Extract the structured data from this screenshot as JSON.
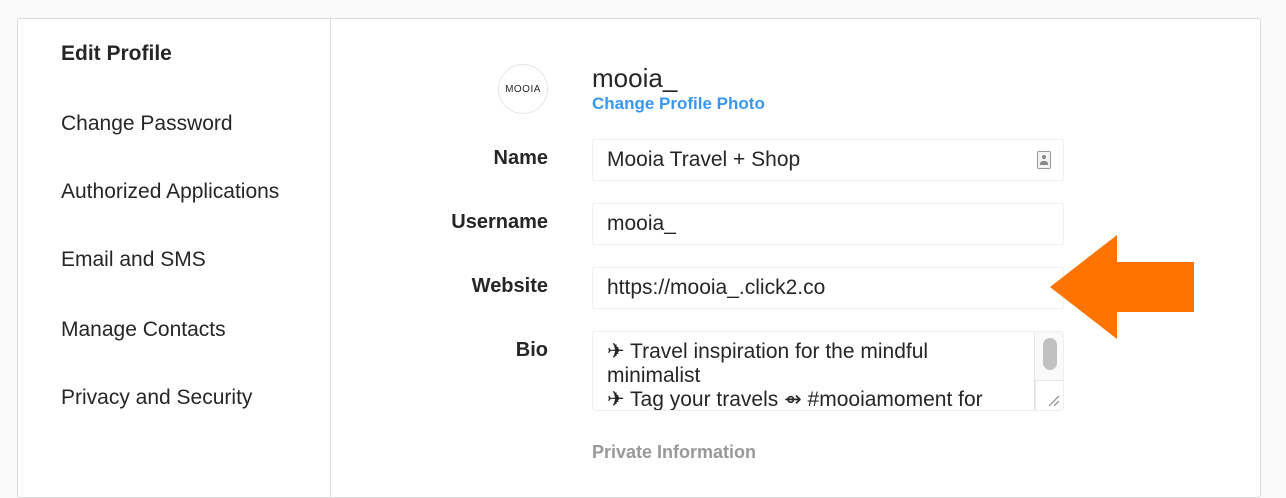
{
  "sidebar": {
    "items": [
      {
        "label": "Edit Profile",
        "active": true
      },
      {
        "label": "Change Password"
      },
      {
        "label": "Authorized Applications"
      },
      {
        "label": "Email and SMS"
      },
      {
        "label": "Manage Contacts"
      },
      {
        "label": "Privacy and Security"
      }
    ]
  },
  "profile": {
    "avatar_text": "MOOIA",
    "username": "mooia_",
    "change_photo_label": "Change Profile Photo"
  },
  "form": {
    "name_label": "Name",
    "name_value": "Mooia Travel + Shop",
    "username_label": "Username",
    "username_value": "mooia_",
    "website_label": "Website",
    "website_value": "https://mooia_.click2.co",
    "bio_label": "Bio",
    "bio_lines": [
      "✈  Travel inspiration for the mindful",
      "minimalist",
      "✈  Tag your travels ⇴ #mooiamoment for"
    ]
  },
  "private_heading": "Private Information",
  "annotation": {
    "arrow_color": "#ff7400"
  }
}
